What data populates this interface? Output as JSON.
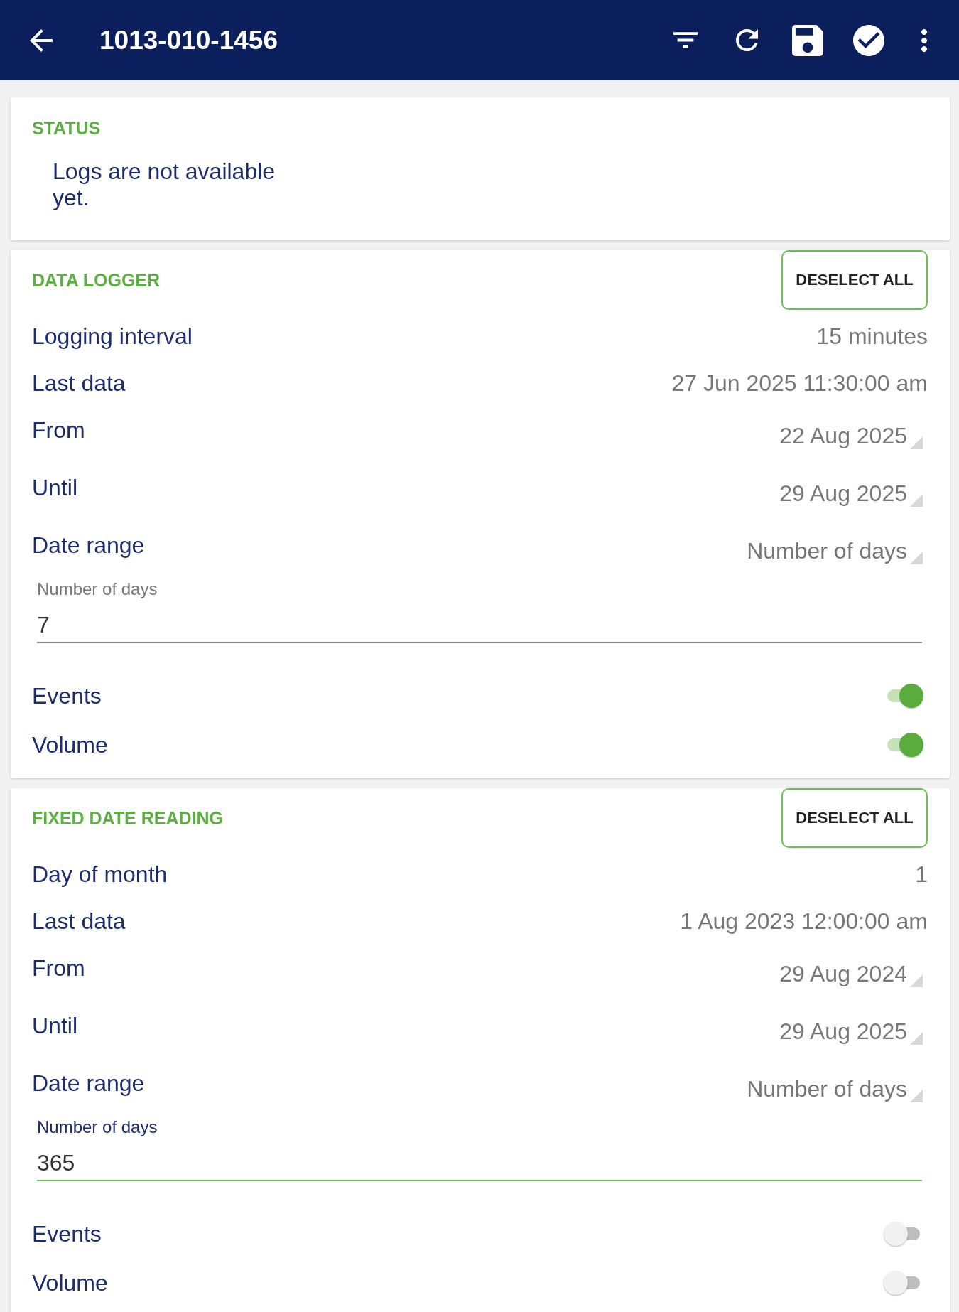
{
  "app_bar": {
    "title": "1013-010-1456"
  },
  "status": {
    "heading": "STATUS",
    "message": "Logs are not available yet."
  },
  "sections": [
    {
      "heading": "DATA LOGGER",
      "button": "DESELECT ALL",
      "rows": [
        {
          "kind": "info",
          "label": "Logging interval",
          "value": "15 minutes"
        },
        {
          "kind": "info",
          "label": "Last data",
          "value": "27 Jun 2025 11:30:00 am"
        },
        {
          "kind": "dropdown",
          "label": "From",
          "value": "22 Aug 2025"
        },
        {
          "kind": "dropdown",
          "label": "Until",
          "value": "29 Aug 2025"
        },
        {
          "kind": "dropdown",
          "label": "Date range",
          "value": "Number of days"
        },
        {
          "kind": "input",
          "label": "Number of days",
          "value": "7",
          "focused": false
        },
        {
          "kind": "switch",
          "label": "Events",
          "on": true
        },
        {
          "kind": "switch",
          "label": "Volume",
          "on": true
        }
      ]
    },
    {
      "heading": "FIXED DATE READING",
      "button": "DESELECT ALL",
      "rows": [
        {
          "kind": "info",
          "label": "Day of month",
          "value": "1"
        },
        {
          "kind": "info",
          "label": "Last data",
          "value": "1 Aug 2023 12:00:00 am"
        },
        {
          "kind": "dropdown",
          "label": "From",
          "value": "29 Aug 2024"
        },
        {
          "kind": "dropdown",
          "label": "Until",
          "value": "29 Aug 2025"
        },
        {
          "kind": "dropdown",
          "label": "Date range",
          "value": "Number of days"
        },
        {
          "kind": "input",
          "label": "Number of days",
          "value": "365",
          "focused": true
        },
        {
          "kind": "switch",
          "label": "Events",
          "on": false
        },
        {
          "kind": "switch",
          "label": "Volume",
          "on": false
        }
      ]
    }
  ]
}
